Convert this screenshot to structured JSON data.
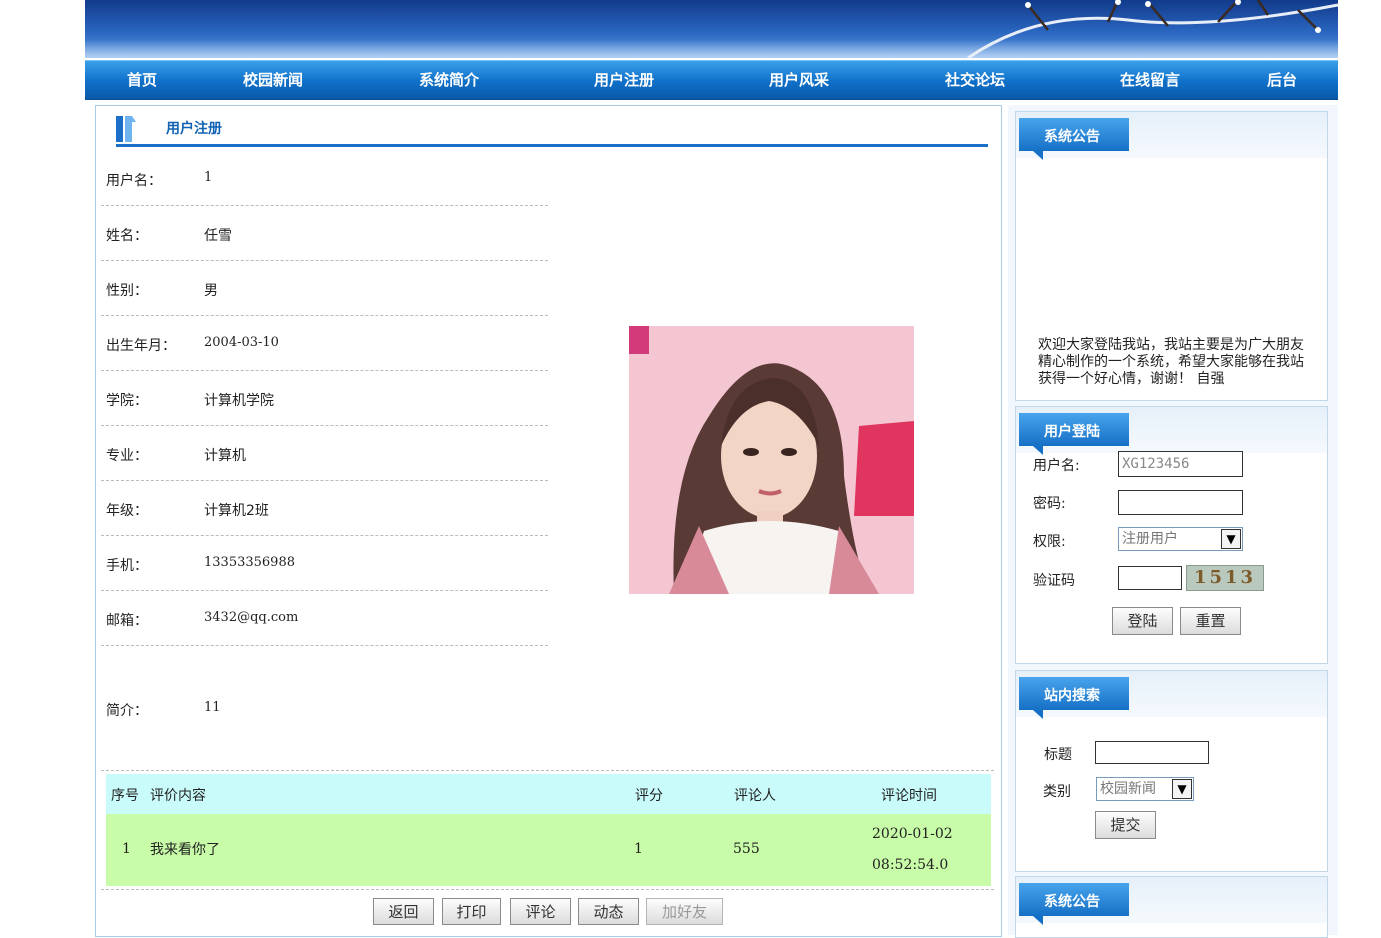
{
  "nav": [
    "首页",
    "校园新闻",
    "系统简介",
    "用户注册",
    "用户风采",
    "社交论坛",
    "在线留言",
    "后台"
  ],
  "section_title": "用户注册",
  "profile": {
    "fields": [
      {
        "label": "用户名：",
        "value": "1"
      },
      {
        "label": "姓名：",
        "value": "任雪"
      },
      {
        "label": "性别：",
        "value": "男"
      },
      {
        "label": "出生年月：",
        "value": "2004-03-10"
      },
      {
        "label": "学院：",
        "value": "计算机学院"
      },
      {
        "label": "专业：",
        "value": "计算机"
      },
      {
        "label": "年级：",
        "value": "计算机2班"
      },
      {
        "label": "手机：",
        "value": "13353356988"
      },
      {
        "label": "邮箱：",
        "value": "3432@qq.com"
      }
    ],
    "intro_label": "简介：",
    "intro_value": "11"
  },
  "comments": {
    "headers": [
      "序号",
      "评价内容",
      "评分",
      "评论人",
      "评论时间"
    ],
    "rows": [
      {
        "no": "1",
        "content": "我来看你了",
        "score": "1",
        "user": "555",
        "date": "2020-01-02",
        "time": "08:52:54.0"
      }
    ]
  },
  "buttons": [
    "返回",
    "打印",
    "评论",
    "动态",
    "加好友"
  ],
  "sidebar": {
    "notice_title": "系统公告",
    "notice_text": "欢迎大家登陆我站，我站主要是为广大朋友精心制作的一个系统，希望大家能够在我站获得一个好心情，谢谢！ 自强",
    "login": {
      "title": "用户登陆",
      "username_label": "用户名:",
      "username_value": "XG123456",
      "password_label": "密码:",
      "role_label": "权限:",
      "role_value": "注册用户",
      "captcha_label": "验证码",
      "captcha_image": "1513",
      "login_btn": "登陆",
      "reset_btn": "重置"
    },
    "search": {
      "title": "站内搜索",
      "title_label": "标题",
      "category_label": "类别",
      "category_value": "校园新闻",
      "submit_btn": "提交"
    },
    "notice2_title": "系统公告"
  },
  "colors": {
    "nav_blue": "#0f6fc8",
    "comment_header": "#c9fbfb",
    "comment_row": "#c8fca8",
    "title_blue": "#1262b3"
  }
}
